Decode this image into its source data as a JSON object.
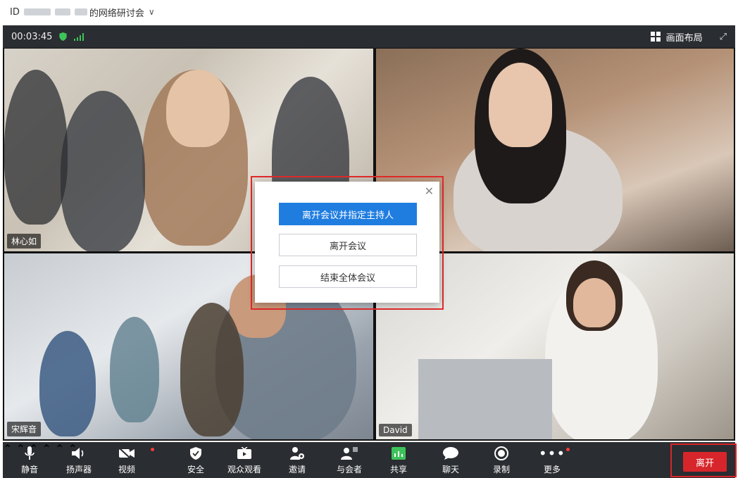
{
  "title": {
    "prefix": "ID",
    "suffix": "的网络研讨会"
  },
  "status": {
    "elapsed": "00:03:45",
    "layout_label": "画面布局"
  },
  "participants": [
    "林心如",
    "宋辉音",
    "David"
  ],
  "dialog": {
    "primary": "离开会议并指定主持人",
    "leave": "离开会议",
    "end_all": "结束全体会议"
  },
  "toolbar": {
    "mute": "静音",
    "speaker": "扬声器",
    "video": "视频",
    "security": "安全",
    "audience": "观众观看",
    "invite": "邀请",
    "attendees": "与会者",
    "share": "共享",
    "chat": "聊天",
    "record": "录制",
    "more": "更多",
    "leave": "离开"
  },
  "colors": {
    "accent": "#1f7de0",
    "danger": "#d7262b",
    "toolbar_bg": "#2a2d31",
    "signal": "#3ec35a"
  }
}
